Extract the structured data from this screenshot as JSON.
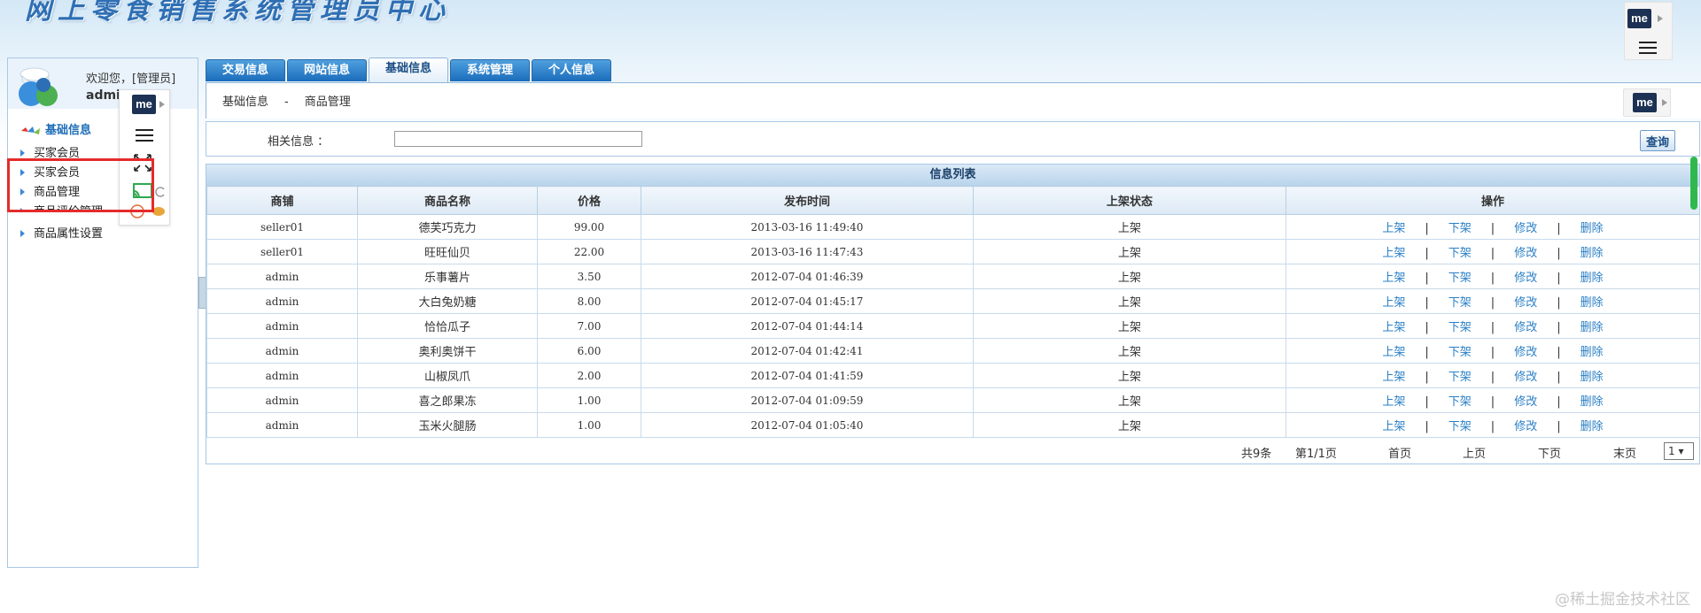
{
  "app": {
    "title": "网上零食销售系统管理员中心"
  },
  "ext_widget": {
    "logo": "me",
    "arrow_icon": "triangle-right-icon",
    "menu_icon": "hamburger-icon"
  },
  "user": {
    "welcome": "欢迎您，[管理员]",
    "name": "admin"
  },
  "sidebar": {
    "section": "基础信息",
    "items": [
      {
        "label": "买家会员"
      },
      {
        "label": "买家会员"
      },
      {
        "label": "商品管理"
      },
      {
        "label": "商品评价管理"
      },
      {
        "label": "商品属性设置"
      }
    ]
  },
  "tabs": [
    {
      "label": "交易信息",
      "active": false
    },
    {
      "label": "网站信息",
      "active": false
    },
    {
      "label": "基础信息",
      "active": true
    },
    {
      "label": "系统管理",
      "active": false
    },
    {
      "label": "个人信息",
      "active": false
    }
  ],
  "breadcrumb": {
    "parent": "基础信息",
    "separator": "-",
    "current": "商品管理"
  },
  "search": {
    "label": "相关信息 ：",
    "value": "",
    "button": "查询"
  },
  "table": {
    "title": "信息列表",
    "columns": [
      "商铺",
      "商品名称",
      "价格",
      "发布时间",
      "上架状态",
      "操作"
    ],
    "actions": [
      "上架",
      "下架",
      "修改",
      "删除"
    ],
    "action_separator": "|",
    "rows": [
      {
        "shop": "seller01",
        "name": "德芙巧克力",
        "price": "99.00",
        "time": "2013-03-16 11:49:40",
        "status": "上架"
      },
      {
        "shop": "seller01",
        "name": "旺旺仙贝",
        "price": "22.00",
        "time": "2013-03-16 11:47:43",
        "status": "上架"
      },
      {
        "shop": "admin",
        "name": "乐事薯片",
        "price": "3.50",
        "time": "2012-07-04 01:46:39",
        "status": "上架"
      },
      {
        "shop": "admin",
        "name": "大白兔奶糖",
        "price": "8.00",
        "time": "2012-07-04 01:45:17",
        "status": "上架"
      },
      {
        "shop": "admin",
        "name": "恰恰瓜子",
        "price": "7.00",
        "time": "2012-07-04 01:44:14",
        "status": "上架"
      },
      {
        "shop": "admin",
        "name": "奥利奥饼干",
        "price": "6.00",
        "time": "2012-07-04 01:42:41",
        "status": "上架"
      },
      {
        "shop": "admin",
        "name": "山椒凤爪",
        "price": "2.00",
        "time": "2012-07-04 01:41:59",
        "status": "上架"
      },
      {
        "shop": "admin",
        "name": "喜之郎果冻",
        "price": "1.00",
        "time": "2012-07-04 01:09:59",
        "status": "上架"
      },
      {
        "shop": "admin",
        "name": "玉米火腿肠",
        "price": "1.00",
        "time": "2012-07-04 01:05:40",
        "status": "上架"
      }
    ]
  },
  "pager": {
    "total": "共9条",
    "page": "第1/1页",
    "first": "首页",
    "prev": "上页",
    "next": "下页",
    "last": "末页",
    "selected": "1"
  },
  "watermark": "@稀土掘金技术社区",
  "colors": {
    "accent": "#1a6cbb",
    "link": "#2a7fc6",
    "highlight": "#e52b2b",
    "logo_bg": "#1c3153",
    "scroll_thumb": "#2fb84e"
  }
}
